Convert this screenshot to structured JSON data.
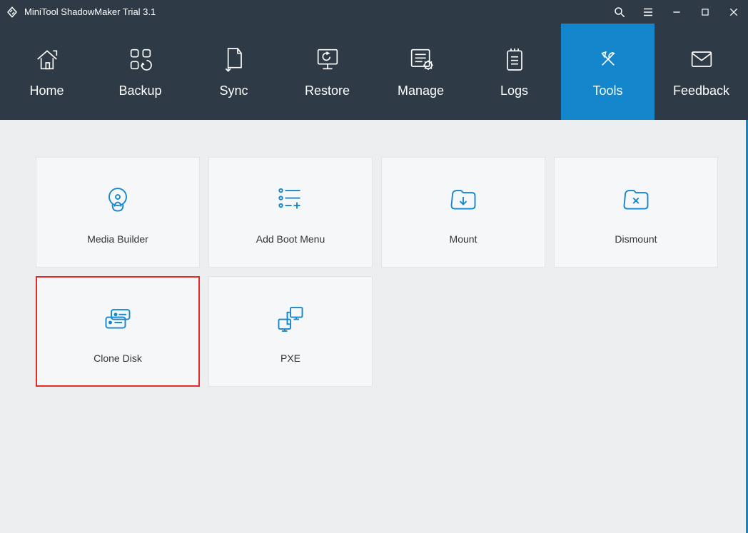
{
  "titlebar": {
    "title": "MiniTool ShadowMaker Trial 3.1"
  },
  "nav": {
    "home": "Home",
    "backup": "Backup",
    "sync": "Sync",
    "restore": "Restore",
    "manage": "Manage",
    "logs": "Logs",
    "tools": "Tools",
    "feedback": "Feedback"
  },
  "tiles": {
    "media_builder": "Media Builder",
    "add_boot_menu": "Add Boot Menu",
    "mount": "Mount",
    "dismount": "Dismount",
    "clone_disk": "Clone Disk",
    "pxe": "PXE"
  },
  "colors": {
    "accent": "#1486cb"
  }
}
